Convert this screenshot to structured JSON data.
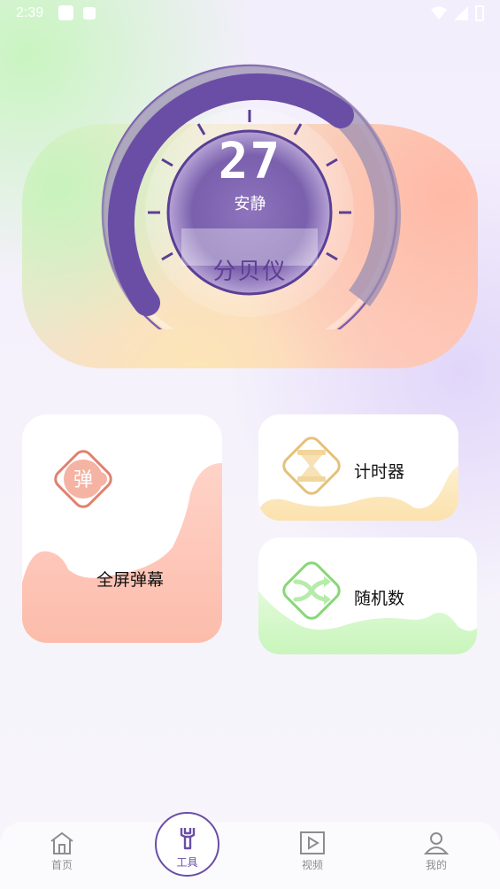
{
  "status_bar": {
    "time": "2:39"
  },
  "meter": {
    "value": "27",
    "level": "安静",
    "title": "分贝仪",
    "arc_fraction": 0.7
  },
  "tools": {
    "danmu": {
      "label": "全屏弹幕",
      "badge": "弹"
    },
    "timer": {
      "label": "计时器"
    },
    "random": {
      "label": "随机数"
    }
  },
  "nav": {
    "home": "首页",
    "tools": "工具",
    "video": "视频",
    "mine": "我的"
  },
  "colors": {
    "accent": "#6a4ea6",
    "danmu": "#e0826f",
    "timer": "#e5c178",
    "random": "#86d877"
  }
}
